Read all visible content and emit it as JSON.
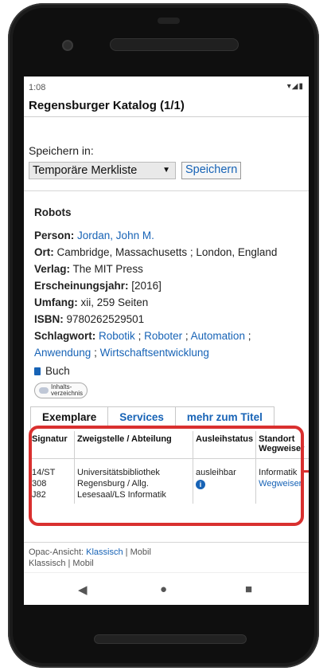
{
  "status": {
    "time": "1:08",
    "icons": "▾◢▮"
  },
  "appbar": {
    "title": "Regensburger Katalog (1/1)"
  },
  "save": {
    "label": "Speichern in:",
    "select_value": "Temporäre Merkliste",
    "button_label": "Speichern"
  },
  "record": {
    "title": "Robots",
    "person_label": "Person:",
    "person_value": "Jordan, John M.",
    "ort_label": "Ort:",
    "ort_value": "Cambridge, Massachusetts ; London, England",
    "verlag_label": "Verlag:",
    "verlag_value": "The MIT Press",
    "jahr_label": "Erscheinungsjahr:",
    "jahr_value": "[2016]",
    "umfang_label": "Umfang:",
    "umfang_value": "xii, 259 Seiten",
    "isbn_label": "ISBN:",
    "isbn_value": "9780262529501",
    "schlagwort_label": "Schlagwort:",
    "schlagwort_1": "Robotik",
    "schlagwort_2": "Roboter",
    "schlagwort_3": "Automation",
    "schlagwort_4": "Anwendung",
    "schlagwort_5": "Wirtschaftsentwicklung",
    "sep": " ;",
    "medium": "Buch",
    "inhalt_line1": "Inhalts-",
    "inhalt_line2": "verzeichnis"
  },
  "tabs": [
    "Exemplare",
    "Services",
    "mehr zum Titel"
  ],
  "table": {
    "headers": [
      "Signatur",
      "Zweigstelle / Abteilung",
      "Ausleihstatus",
      "Standort",
      "Wegweiser"
    ],
    "row": {
      "signatur": [
        "14/ST",
        "308",
        "J82"
      ],
      "zweig": [
        "Universitätsbibliothek",
        "Regensburg / Allg.",
        "Lesesaal/LS Informatik"
      ],
      "status": "ausleihbar",
      "standort": "Informatik",
      "wegweiser": "Wegweiser"
    }
  },
  "footer": {
    "label": "Opac-Ansicht:",
    "klassisch": "Klassisch",
    "pipe": " | ",
    "mobil": "Mobil",
    "line2": "Klassisch  |  Mobil"
  },
  "nav": {
    "back": "◀",
    "home": "●",
    "recents": "■"
  },
  "colors": {
    "link": "#1763b6",
    "highlight": "#d9302f"
  }
}
